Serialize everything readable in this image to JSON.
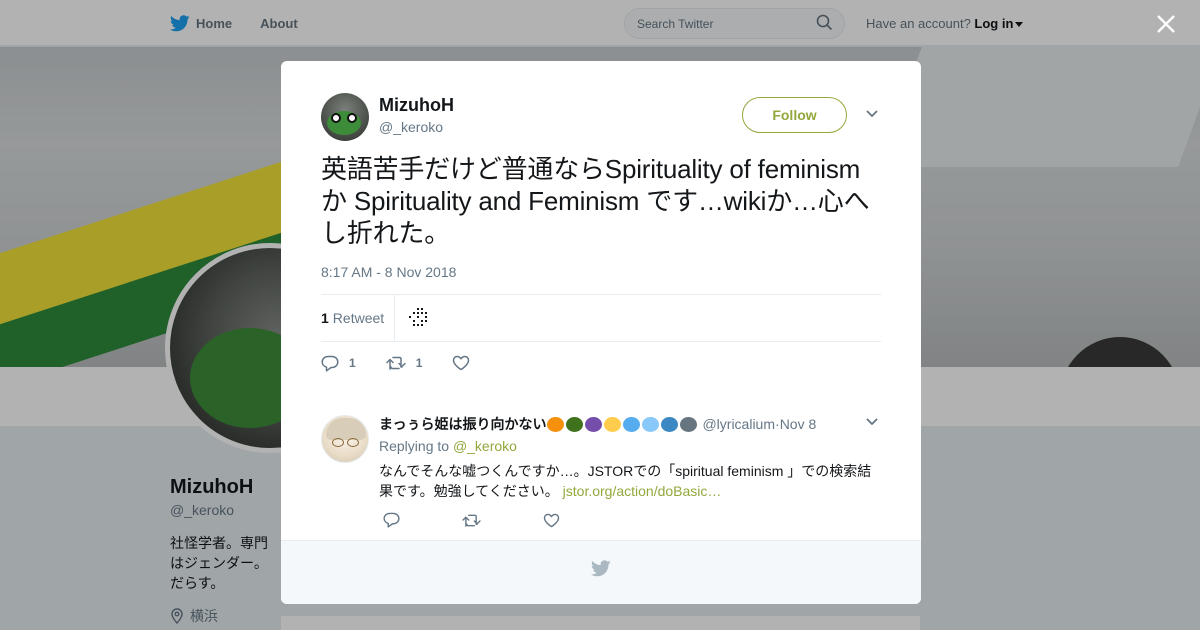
{
  "topbar": {
    "nav": [
      {
        "label": "Home",
        "icon": "twitter-bird-icon"
      },
      {
        "label": "About"
      }
    ],
    "search_placeholder": "Search Twitter",
    "account_prompt": "Have an account?",
    "login_label": "Log in"
  },
  "background_profile": {
    "name": "MizuhoH",
    "handle": "@_keroko",
    "bio": "社怪学者。専門はジェンダー。だらす。",
    "location": "横浜"
  },
  "tweet": {
    "author_name": "MizuhoH",
    "author_handle": "@_keroko",
    "follow_label": "Follow",
    "text": "英語苦手だけど普通ならSpirituality of feminism か Spirituality and Feminism です…wikiか…心へし折れた。",
    "timestamp": "8:17 AM - 8 Nov 2018",
    "retweet_count": "1",
    "retweet_label": "Retweet",
    "reply_count": "1",
    "retweet_action_count": "1"
  },
  "reply": {
    "author_name": "まっぅら姫は振り向かない",
    "author_handle": "@lyricalium",
    "separator": " · ",
    "date": "Nov 8",
    "replying_prefix": "Replying to ",
    "replying_handle": "@_keroko",
    "text": "なんでそんな嘘つくんですか…。JSTORでの「spiritual feminism 」での検索結果です。勉強してください。 ",
    "link": "jstor.org/action/doBasic…",
    "emoji_colors": [
      "#f4900c",
      "#3e721d",
      "#744eaa",
      "#ffcc4d",
      "#55acee",
      "#88c9f9",
      "#3b88c3",
      "#66757f"
    ]
  },
  "colors": {
    "brand_blue": "#1da1f2",
    "accent_green": "#91a83b",
    "muted_text": "#657786"
  }
}
